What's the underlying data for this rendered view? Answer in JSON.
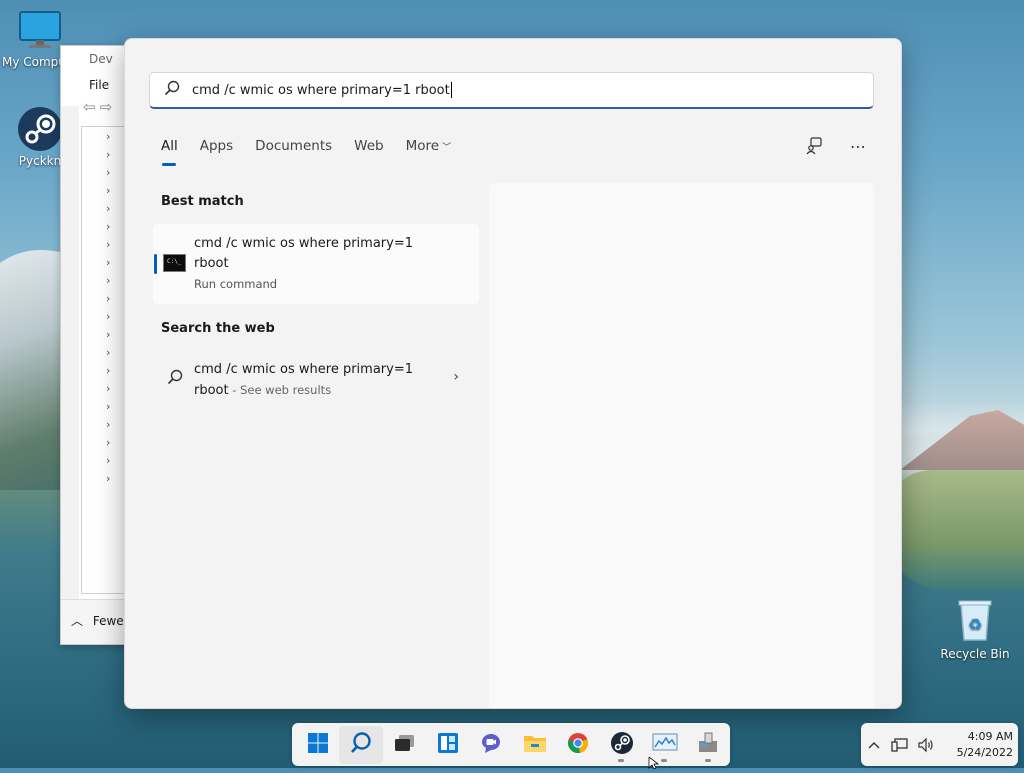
{
  "desktop": {
    "icons": [
      {
        "label": "My Compu",
        "icon": "monitor-icon"
      },
      {
        "label": "Pyckkn",
        "icon": "steam-icon"
      },
      {
        "label": "Recycle Bin",
        "icon": "recycle-bin-icon"
      }
    ]
  },
  "background_window": {
    "title": "Dev",
    "menu_file": "File",
    "fewer_label": "Fewer"
  },
  "search": {
    "query": "cmd /c wmic os where primary=1 rboot",
    "tabs": [
      "All",
      "Apps",
      "Documents",
      "Web",
      "More"
    ],
    "active_tab": "All",
    "best_match_heading": "Best match",
    "best_match": {
      "line1": "cmd /c wmic os where primary=1",
      "line2": "rboot",
      "subtitle": "Run command"
    },
    "web_heading": "Search the web",
    "web_result": {
      "line1": "cmd /c wmic os where primary=1",
      "line2": "rboot",
      "suffix": " - See web results"
    }
  },
  "taskbar": {
    "items": [
      "start-icon",
      "search-icon",
      "task-view-icon",
      "widgets-icon",
      "chat-icon",
      "file-explorer-icon",
      "chrome-icon",
      "steam-icon",
      "performance-monitor-icon",
      "device-manager-icon"
    ]
  },
  "tray": {
    "time": "4:09 AM",
    "date": "5/24/2022"
  },
  "colors": {
    "accent": "#005fb8",
    "panel_bg": "#f3f3f3"
  }
}
